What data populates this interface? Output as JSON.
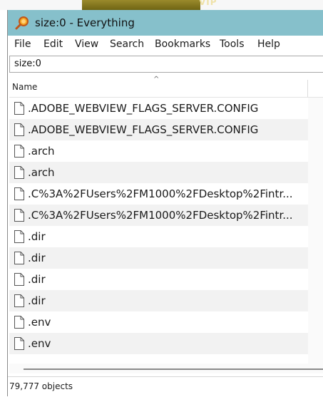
{
  "background": {
    "banner_text": "VIP"
  },
  "window": {
    "title": "size:0 - Everything",
    "accent_color": "#86c0cb",
    "icon": "magnifier-icon"
  },
  "menu": [
    "File",
    "Edit",
    "View",
    "Search",
    "Bookmarks",
    "Tools",
    "Help"
  ],
  "search": {
    "value": "size:0"
  },
  "columns": {
    "name": "Name",
    "sort_indicator": "^"
  },
  "files": [
    ".ADOBE_WEBVIEW_FLAGS_SERVER.CONFIG",
    ".ADOBE_WEBVIEW_FLAGS_SERVER.CONFIG",
    ".arch",
    ".arch",
    ".C%3A%2FUsers%2FM1000%2FDesktop%2Fintr...",
    ".C%3A%2FUsers%2FM1000%2FDesktop%2Fintr...",
    ".dir",
    ".dir",
    ".dir",
    ".dir",
    ".env",
    ".env"
  ],
  "status": {
    "text": "79,777 objects"
  }
}
